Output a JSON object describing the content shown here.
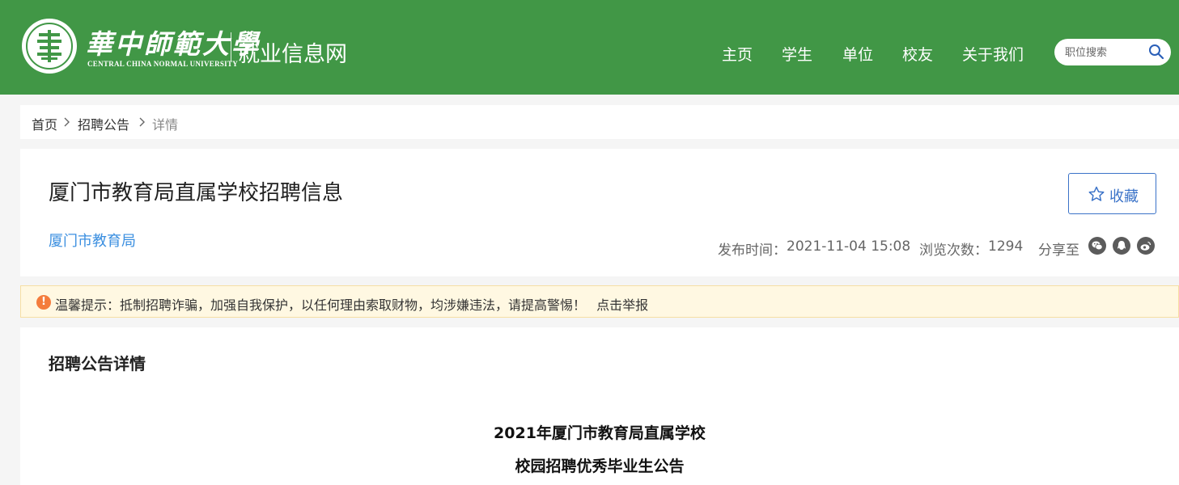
{
  "header": {
    "logo_cn": "華中師範大學",
    "logo_en": "CENTRAL CHINA NORMAL UNIVERSITY",
    "site_name": "就业信息网",
    "brand_color": "#419746",
    "nav": [
      {
        "label": "主页"
      },
      {
        "label": "学生"
      },
      {
        "label": "单位"
      },
      {
        "label": "校友"
      },
      {
        "label": "关于我们"
      }
    ],
    "search": {
      "placeholder": "职位搜索",
      "value": "",
      "icon": "search-icon"
    }
  },
  "breadcrumb": {
    "items": [
      {
        "label": "首页"
      },
      {
        "label": "招聘公告"
      },
      {
        "label": "详情"
      }
    ]
  },
  "job": {
    "title": "厦门市教育局直属学校招聘信息",
    "favorite_label": "收藏",
    "company": "厦门市教育局",
    "publish_label": "发布时间：",
    "publish_time": "2021-11-04 15:08",
    "views_label": "浏览次数：",
    "views": "1294",
    "share_label": "分享至",
    "share_icons": [
      "wechat-icon",
      "qq-icon",
      "weibo-icon"
    ],
    "accent_color": "#3b73c8"
  },
  "warning": {
    "text": "温馨提示：抵制招聘诈骗，加强自我保护，以任何理由索取财物，均涉嫌违法，请提高警惕！",
    "report_link": "点击举报",
    "icon": "warning-icon"
  },
  "details": {
    "heading": "招聘公告详情",
    "lines": [
      "2021年厦门市教育局直属学校",
      "校园招聘优秀毕业生公告"
    ]
  }
}
